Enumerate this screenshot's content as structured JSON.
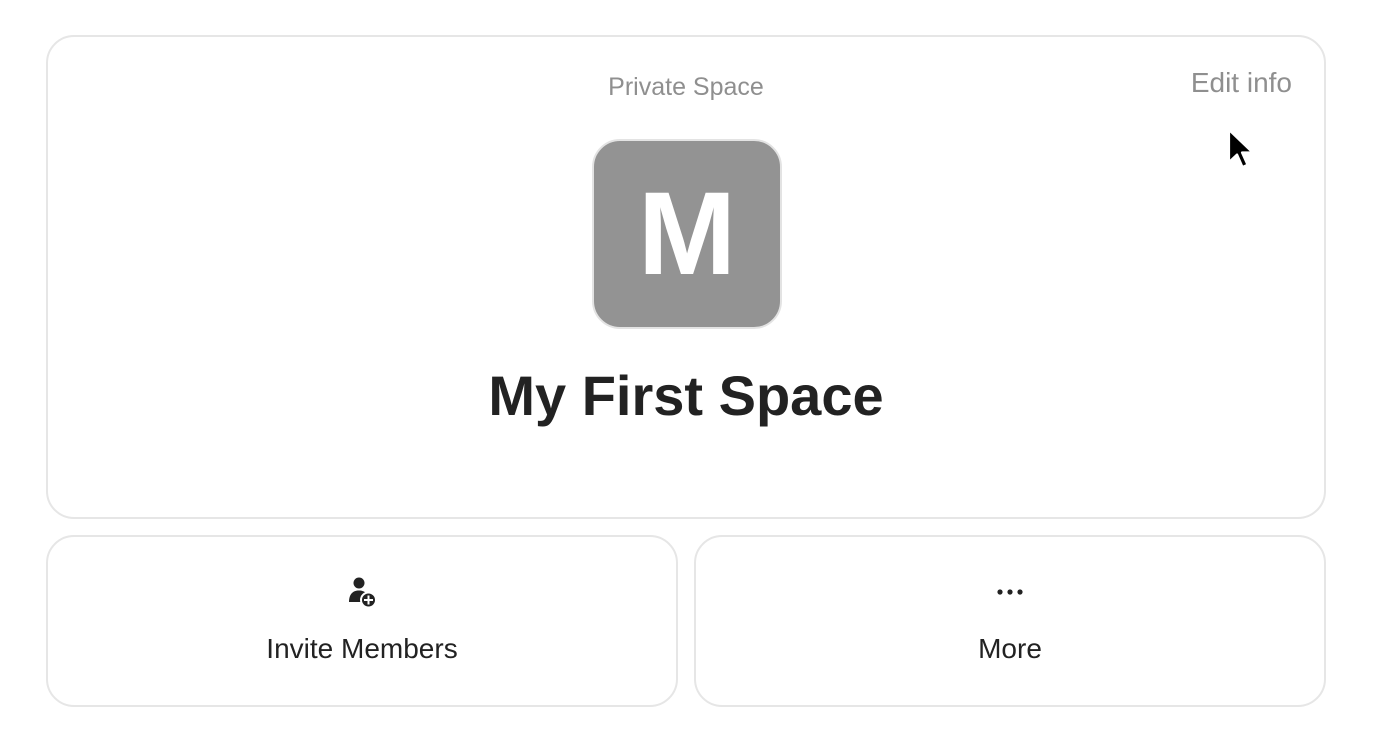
{
  "space": {
    "type_label": "Private Space",
    "edit_label": "Edit info",
    "avatar_letter": "M",
    "name": "My First Space"
  },
  "actions": {
    "invite": {
      "label": "Invite Members",
      "icon": "user-plus-icon"
    },
    "more": {
      "label": "More",
      "icon": "ellipsis-icon"
    }
  },
  "colors": {
    "avatar_bg": "#939393",
    "muted_text": "#8f8f8f",
    "primary_text": "#222222",
    "card_border": "#e6e6e6"
  }
}
